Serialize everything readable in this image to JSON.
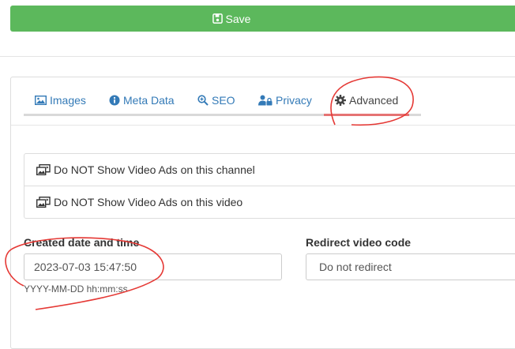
{
  "save_button": {
    "label": "Save"
  },
  "tabs": [
    {
      "label": "Images",
      "icon": "image-icon"
    },
    {
      "label": "Meta Data",
      "icon": "info-circle-icon"
    },
    {
      "label": "SEO",
      "icon": "search-plus-icon"
    },
    {
      "label": "Privacy",
      "icon": "user-lock-icon"
    },
    {
      "label": "Advanced",
      "icon": "gear-icon",
      "active": true
    }
  ],
  "options": [
    {
      "label": "Do NOT Show Video Ads on this channel",
      "icon": "photo-video-icon"
    },
    {
      "label": "Do NOT Show Video Ads on this video",
      "icon": "photo-video-icon"
    }
  ],
  "created": {
    "label": "Created date and time",
    "value": "2023-07-03 15:47:50",
    "help": "YYYY-MM-DD hh:mm:ss"
  },
  "redirect": {
    "label": "Redirect video code",
    "value": "Do not redirect"
  },
  "colors": {
    "save": "#5cb85c",
    "link": "#337ab7",
    "annotation": "#e53935"
  }
}
